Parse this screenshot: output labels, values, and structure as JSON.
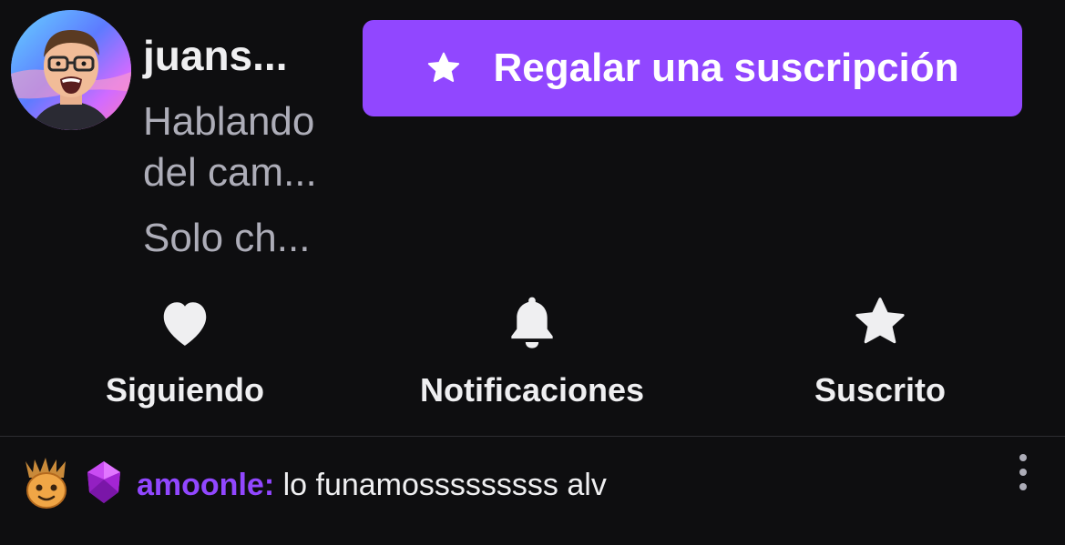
{
  "channel": {
    "name": "juans...",
    "title": "Hablando del cam...",
    "category": "Solo ch..."
  },
  "gift_button": {
    "label": "Regalar una suscripción",
    "icon": "star-icon",
    "color": "#9147ff"
  },
  "actions": [
    {
      "label": "Siguiendo",
      "icon": "heart-icon"
    },
    {
      "label": "Notificaciones",
      "icon": "bell-icon"
    },
    {
      "label": "Suscrito",
      "icon": "star-icon"
    }
  ],
  "chat": {
    "badges": [
      "groot-badge-icon",
      "purple-gem-badge-icon"
    ],
    "username": "amoonle",
    "separator": ":",
    "message": "lo funamosssssssss alv",
    "username_color": "#9147ff",
    "more_icon": "more-vertical-icon"
  },
  "colors": {
    "background": "#0e0e10",
    "text": "#efeff1",
    "muted": "#adadb8",
    "accent": "#9147ff"
  }
}
